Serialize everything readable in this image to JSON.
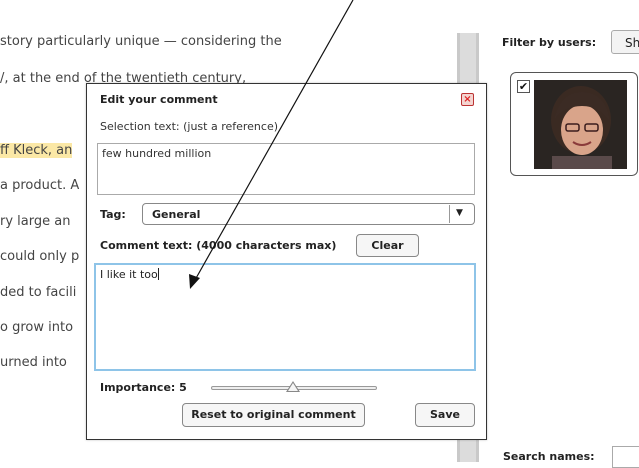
{
  "document": {
    "lines": [
      "story particularly unique — considering the",
      "/, at the end of the twentieth century,",
      "ff Kleck, an",
      "a product. A",
      "ry large an",
      "could only p",
      "ded to facili",
      "o grow into",
      "urned into"
    ]
  },
  "right_panel": {
    "filter_label": "Filter by users:",
    "filter_button": "Sh",
    "user_checked": "✔",
    "search_label": "Search names:"
  },
  "dialog": {
    "title": "Edit your comment",
    "close_glyph": "×",
    "selection_label": "Selection text: (just a reference)",
    "selection_text": "few hundred million",
    "tag_label": "Tag:",
    "tag_value": "General",
    "tag_arrow": "▼",
    "comment_label": "Comment text: (4000 characters max)",
    "clear_button": "Clear",
    "comment_text": "I like it too",
    "importance_label": "Importance: 5",
    "importance_value": 5,
    "reset_button": "Reset to original comment",
    "save_button": "Save"
  },
  "colors": {
    "highlight": "#fbe8a6",
    "focus_border": "#8ec4e8",
    "close_red": "#d22"
  },
  "icons": [
    "close-icon",
    "checkbox-check-icon",
    "dropdown-arrow-icon",
    "slider-thumb-icon",
    "annotation-arrow"
  ]
}
